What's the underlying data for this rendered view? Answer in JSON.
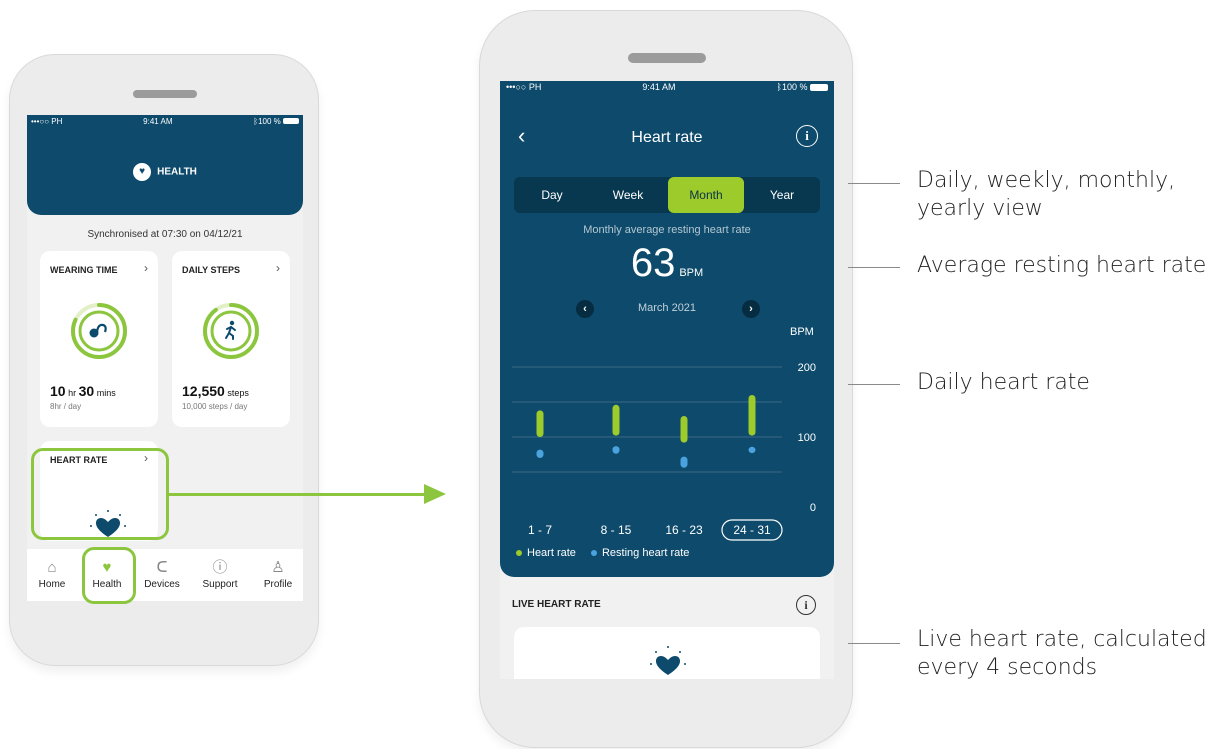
{
  "left_phone": {
    "status": {
      "carrier": "•••○○ PH",
      "time": "9:41 AM",
      "battery": "100 %"
    },
    "header_title": "HEALTH",
    "sync_text": "Synchronised at 07:30 on 04/12/21",
    "wearing_time": {
      "title": "WEARING TIME",
      "hours": "10",
      "hours_unit": "hr",
      "mins": "30",
      "mins_unit": "mins",
      "sub": "8hr / day",
      "progress": 0.82
    },
    "daily_steps": {
      "title": "DAILY STEPS",
      "value": "12,550",
      "unit": "steps",
      "sub": "10,000 steps / day",
      "progress": 0.9
    },
    "heart_rate_card": {
      "title": "HEART RATE"
    },
    "nav": [
      {
        "label": "Home",
        "icon": "home-icon"
      },
      {
        "label": "Health",
        "icon": "heart-icon"
      },
      {
        "label": "Devices",
        "icon": "hearing-aid-icon"
      },
      {
        "label": "Support",
        "icon": "help-icon"
      },
      {
        "label": "Profile",
        "icon": "user-icon"
      }
    ]
  },
  "right_phone": {
    "status": {
      "carrier": "•••○○ PH",
      "time": "9:41 AM",
      "battery": "100 %"
    },
    "title": "Heart rate",
    "periods": [
      "Day",
      "Week",
      "Month",
      "Year"
    ],
    "active_period": "Month",
    "avg_label": "Monthly average resting heart rate",
    "avg_value": "63",
    "avg_unit": "BPM",
    "month": "March 2021",
    "bpm_label": "BPM",
    "legend": [
      {
        "label": "Heart rate",
        "color": "#9ccb2b"
      },
      {
        "label": "Resting heart rate",
        "color": "#4aa3de"
      }
    ],
    "live_label": "LIVE HEART RATE"
  },
  "chart_data": {
    "type": "bar",
    "categories": [
      "1 - 7",
      "8 - 15",
      "16 - 23",
      "24 - 31"
    ],
    "selected_category": "24 - 31",
    "y_ticks": [
      0,
      100,
      200
    ],
    "ylim": [
      0,
      200
    ],
    "ylabel": "BPM",
    "series": [
      {
        "name": "Heart rate",
        "color": "#9ccb2b",
        "ranges": [
          [
            100,
            138
          ],
          [
            102,
            146
          ],
          [
            92,
            130
          ],
          [
            102,
            160
          ]
        ]
      },
      {
        "name": "Resting heart rate",
        "color": "#4aa3de",
        "ranges": [
          [
            70,
            82
          ],
          [
            76,
            87
          ],
          [
            56,
            72
          ],
          [
            77,
            86
          ]
        ]
      }
    ]
  },
  "callouts": [
    {
      "text_line1": "Daily, weekly, monthly,",
      "text_line2": "yearly view"
    },
    {
      "text_line1": "Average resting heart rate",
      "text_line2": ""
    },
    {
      "text_line1": "Daily heart rate",
      "text_line2": ""
    },
    {
      "text_line1": "Live heart rate, calculated",
      "text_line2": "every 4 seconds"
    }
  ]
}
